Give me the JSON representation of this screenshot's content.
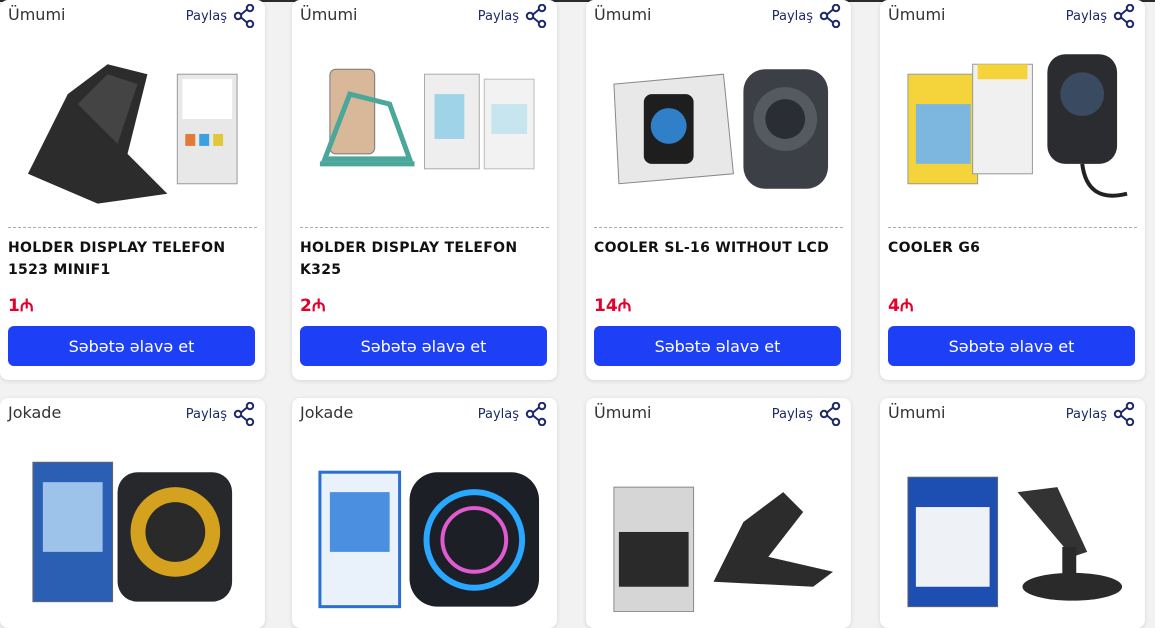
{
  "share_label": "Paylaş",
  "add_to_cart_label": "Səbətə əlavə et",
  "accent_color": "#1d3ff5",
  "price_color": "#e3002b",
  "products": [
    {
      "category": "Ümumi",
      "name": "HOLDER DISPLAY TELEFON 1523 MINIF1",
      "price": "1₼",
      "image": "phone-stand-black"
    },
    {
      "category": "Ümumi",
      "name": "HOLDER DISPLAY TELEFON K325",
      "price": "2₼",
      "image": "phone-stand-green"
    },
    {
      "category": "Ümumi",
      "name": "COOLER SL-16 WITHOUT LCD",
      "price": "14₼",
      "image": "phone-cooler-sl16"
    },
    {
      "category": "Ümumi",
      "name": "COOLER G6",
      "price": "4₼",
      "image": "phone-cooler-g6"
    },
    {
      "category": "Jokade",
      "name": "",
      "price": "",
      "image": "phone-cooler-jokade-yellow"
    },
    {
      "category": "Jokade",
      "name": "",
      "price": "",
      "image": "phone-cooler-jokade-blue"
    },
    {
      "category": "Ümumi",
      "name": "",
      "price": "",
      "image": "foldable-phone-stand"
    },
    {
      "category": "Ümumi",
      "name": "",
      "price": "",
      "image": "rotatable-desktop-holder"
    }
  ]
}
